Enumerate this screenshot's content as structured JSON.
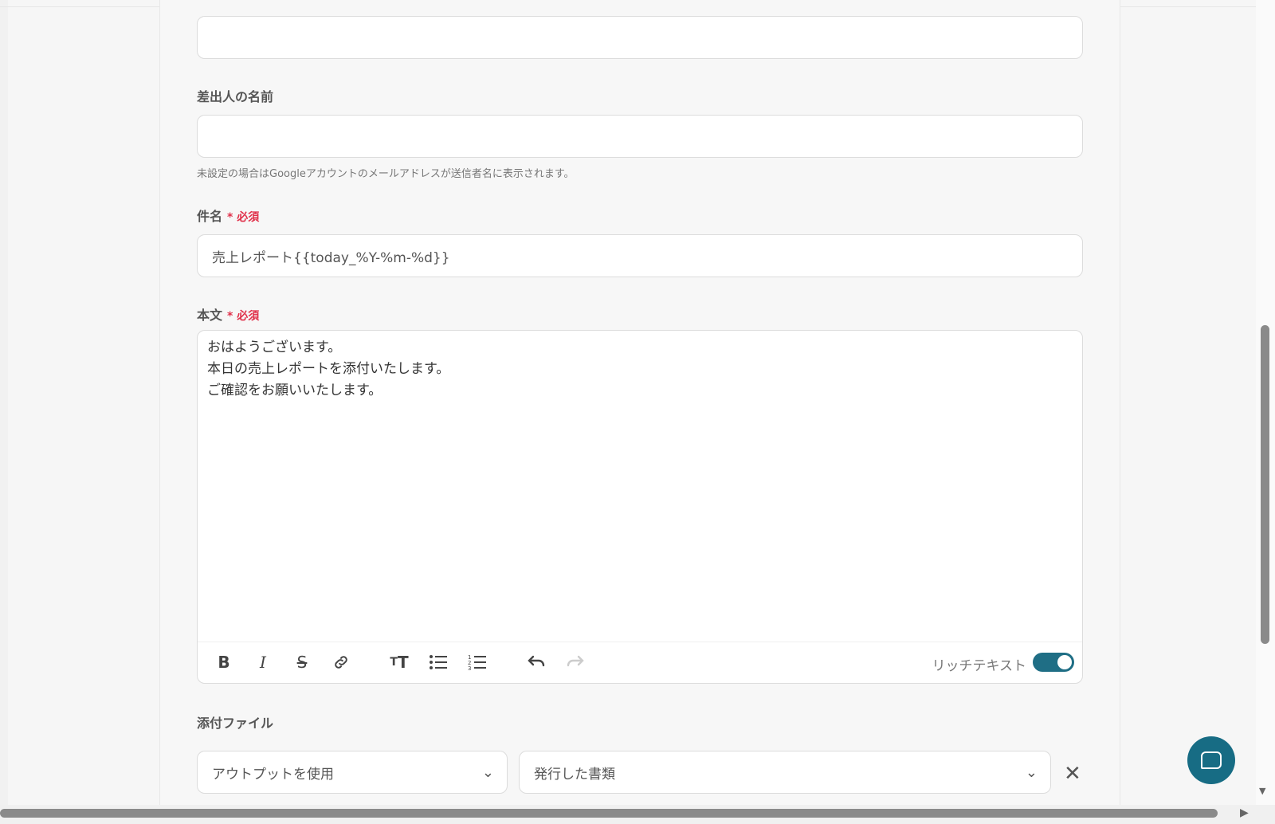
{
  "fields": {
    "sender_name": {
      "label": "差出人の名前",
      "value": "",
      "hint": "未設定の場合はGoogleアカウントのメールアドレスが送信者名に表示されます。"
    },
    "subject": {
      "label": "件名",
      "required": "* 必須",
      "value": "売上レポート{{today_%Y-%m-%d}}"
    },
    "body": {
      "label": "本文",
      "required": "* 必須",
      "lines": [
        "おはようございます。",
        "本日の売上レポートを添付いたします。",
        "ご確認をお願いいたします。"
      ]
    },
    "attachment": {
      "label": "添付ファイル",
      "source_value": "アウトプットを使用",
      "output_value": "発行した書類"
    }
  },
  "toolbar": {
    "rich_text_label": "リッチテキスト",
    "rich_text_enabled": true
  },
  "colors": {
    "accent": "#1f6e85",
    "required": "#e0304a"
  }
}
